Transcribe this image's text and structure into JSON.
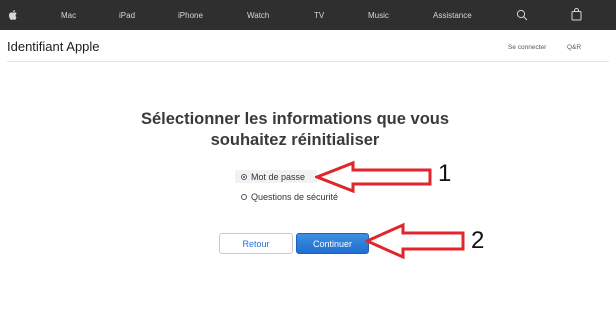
{
  "nav": {
    "items": [
      {
        "name": "nav-mac",
        "label": "Mac"
      },
      {
        "name": "nav-ipad",
        "label": "iPad"
      },
      {
        "name": "nav-iphone",
        "label": "iPhone"
      },
      {
        "name": "nav-watch",
        "label": "Watch"
      },
      {
        "name": "nav-tv",
        "label": "TV"
      },
      {
        "name": "nav-music",
        "label": "Music"
      },
      {
        "name": "nav-assistance",
        "label": "Assistance"
      }
    ],
    "icons": [
      "apple-logo-icon",
      "search-icon",
      "shopping-bag-icon"
    ]
  },
  "header": {
    "title": "Identifiant Apple",
    "signin_label": "Se connecter",
    "faq_label": "Q&R"
  },
  "main": {
    "heading_line1": "Sélectionner les informations que vous",
    "heading_line2": "souhaitez réinitialiser",
    "options": [
      {
        "label": "Mot de passe",
        "selected": true
      },
      {
        "label": "Questions de sécurité",
        "selected": false
      }
    ],
    "back_label": "Retour",
    "continue_label": "Continuer"
  },
  "annotations": {
    "arrow_color": "#e0262b",
    "marker_1": "1",
    "marker_2": "2"
  }
}
